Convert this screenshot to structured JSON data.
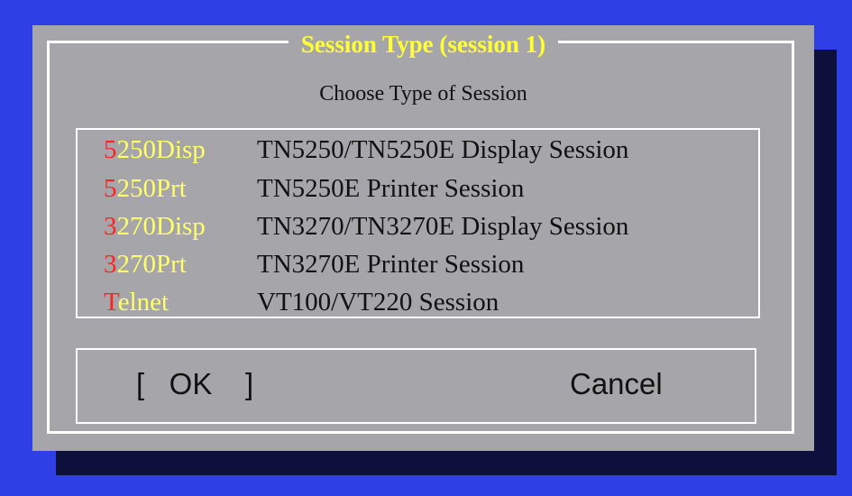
{
  "dialog": {
    "title": "Session Type (session 1)",
    "subtitle": "Choose Type of Session"
  },
  "sessions": [
    {
      "hotkey": "5",
      "code_rest": "250Disp",
      "description": "TN5250/TN5250E Display Session"
    },
    {
      "hotkey": "5",
      "code_rest": "250Prt",
      "description": "TN5250E Printer Session"
    },
    {
      "hotkey": "3",
      "code_rest": "270Disp",
      "description": "TN3270/TN3270E Display Session"
    },
    {
      "hotkey": "3",
      "code_rest": "270Prt",
      "description": "TN3270E Printer Session"
    },
    {
      "hotkey": "T",
      "code_rest": "elnet",
      "description": "VT100/VT220 Session"
    }
  ],
  "buttons": {
    "ok_label": "[   OK    ]",
    "cancel_label": "Cancel"
  },
  "colors": {
    "background": "#2f3fe6",
    "dialog": "#a6a6aa",
    "title": "#ffff33",
    "hotkey": "#ff2020",
    "code": "#ffff66"
  }
}
